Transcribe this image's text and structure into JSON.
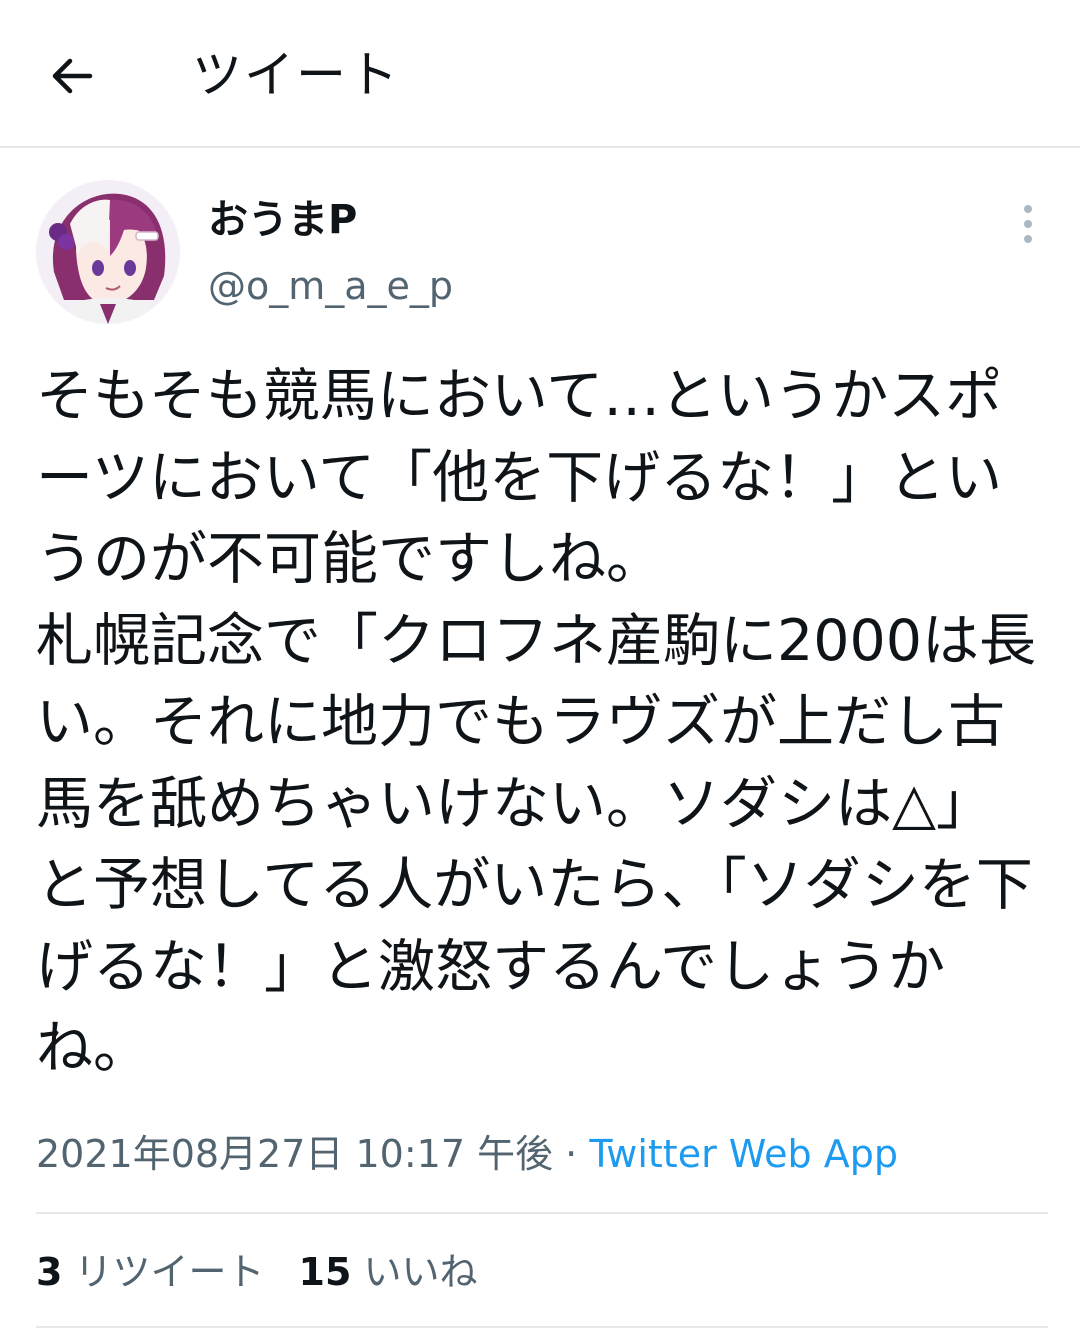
{
  "header": {
    "back_icon": "arrow-left-icon",
    "title": "ツイート"
  },
  "author": {
    "display_name": "おうまP",
    "handle": "@o_m_a_e_p",
    "avatar_icon": "anime-character-avatar",
    "more_icon": "more-vertical-icon"
  },
  "tweet": {
    "text": "そもそも競馬において…というかスポーツにおいて「他を下げるな！」というのが不可能ですしね。\n札幌記念で「クロフネ産駒に2000は長い。それに地力でもラヴズが上だし古馬を舐めちゃいけない。ソダシは△」と予想してる人がいたら、「ソダシを下げるな！」と激怒するんでしょうかね。"
  },
  "meta": {
    "timestamp": "2021年08月27日 10:17 午後",
    "separator": " · ",
    "source": "Twitter Web App"
  },
  "stats": {
    "retweet_count": "3",
    "retweet_label": " リツイート",
    "like_count": "15",
    "like_label": " いいね"
  },
  "colors": {
    "text": "#0f1419",
    "secondary": "#536471",
    "link": "#1d9bf0",
    "divider": "#e6e9eb"
  }
}
